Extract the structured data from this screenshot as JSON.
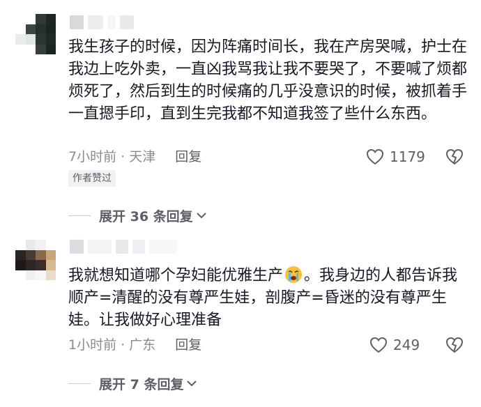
{
  "comments": [
    {
      "text": "我生孩子的时候，因为阵痛时间长，我在产房哭喊，护士在我边上吃外卖，一直凶我骂我让我不要哭了，不要喊了烦都烦死了，然后到生的时候痛的几乎没意识的时候，被抓着手一直摁手印，直到生完我都不知道我签了些什么东西。",
      "time_location": "7小时前 · 天津",
      "reply_label": "回复",
      "like_count": "1179",
      "badge": "作者赞过",
      "expand_label": "展开 36 条回复"
    },
    {
      "text_before_emoji": "我就想知道哪个孕妇能优雅生产",
      "emoji": "crying-face-emoji",
      "text_after_emoji": "。我身边的人都告诉我顺产=清醒的没有尊严生娃，剖腹产=昏迷的没有尊严生娃。让我做好心理准备",
      "time_location": "1小时前 · 广东",
      "reply_label": "回复",
      "like_count": "249",
      "expand_label": "展开 7 条回复"
    }
  ],
  "colors": {
    "text": "#161823",
    "meta": "#8a8b91",
    "action": "#5d5e66",
    "badge_bg": "#f2f2f4"
  }
}
